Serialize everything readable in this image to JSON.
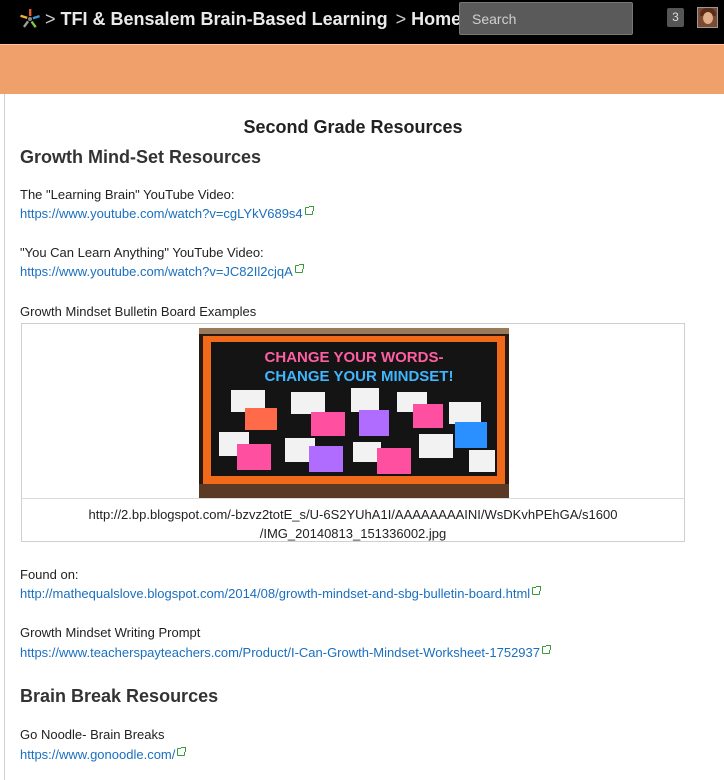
{
  "header": {
    "crumbs": [
      {
        "label": "TFI & Bensalem Brain-Based Learning"
      },
      {
        "label": "Home"
      }
    ],
    "search_placeholder": "Search",
    "notification_count": "3"
  },
  "page": {
    "title": "Second Grade Resources",
    "sections": [
      {
        "heading": "Growth Mind-Set Resources"
      },
      {
        "heading": "Brain Break Resources"
      }
    ],
    "items": [
      {
        "label": "The \"Learning Brain\" YouTube Video:",
        "url": "https://www.youtube.com/watch?v=cgLYkV689s4"
      },
      {
        "label": "\"You Can Learn Anything\" YouTube Video:",
        "url": "https://www.youtube.com/watch?v=JC82Il2cjqA"
      },
      {
        "label": "Growth Mindset Bulletin Board Examples"
      },
      {
        "label": "Found on:",
        "url": "http://mathequalslove.blogspot.com/2014/08/growth-mindset-and-sbg-bulletin-board.html"
      },
      {
        "label": "Growth Mindset Writing Prompt",
        "url": "https://www.teacherspayteachers.com/Product/I-Can-Growth-Mindset-Worksheet-1752937"
      },
      {
        "label": "Go Noodle- Brain Breaks",
        "url": "https://www.gonoodle.com/"
      }
    ],
    "image_caption_line1": "http://2.bp.blogspot.com/-bzvz2totE_s/U-6S2YUhA1I/AAAAAAAAINI/WsDKvhPEhGA/s1600",
    "image_caption_line2": "/IMG_20140813_151336002.jpg",
    "bulletin": {
      "line1": "CHANGE YOUR WORDS-",
      "line2": "CHANGE YOUR MINDSET!"
    }
  },
  "colors": {
    "topbar": "#000000",
    "accent_orange": "#f0a06a",
    "link": "#1a6fbf",
    "external_icon": "#3a9a3a"
  }
}
